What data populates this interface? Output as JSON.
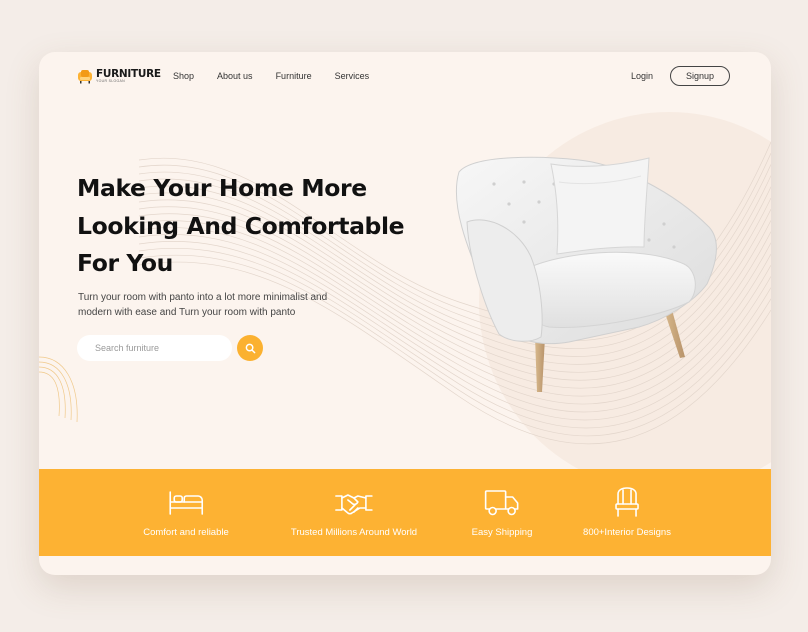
{
  "brand": {
    "name": "FURNITURE",
    "tagline": "YOUR SLOGAN",
    "logo_icon": "armchair-logo-icon"
  },
  "nav": {
    "items": [
      {
        "label": "Shop"
      },
      {
        "label": "About us"
      },
      {
        "label": "Furniture"
      },
      {
        "label": "Services"
      }
    ]
  },
  "auth": {
    "login_label": "Login",
    "signup_label": "Signup"
  },
  "hero": {
    "title_lines": [
      "Make Your Home More",
      "Looking And Comfortable",
      "For You"
    ],
    "subtitle": "Turn your room with panto into a lot more minimalist and modern with ease and Turn your room with panto",
    "search_placeholder": "Search furniture",
    "search_icon": "search-icon",
    "image": "white-armchair"
  },
  "features": [
    {
      "label": "Comfort and reliable",
      "icon": "bed-icon"
    },
    {
      "label": "Trusted Millions Around World",
      "icon": "handshake-icon"
    },
    {
      "label": "Easy Shipping",
      "icon": "truck-icon"
    },
    {
      "label": "800+Interior Designs",
      "icon": "chair-icon"
    }
  ],
  "colors": {
    "accent": "#FDB233",
    "page_bg": "#F4EDE8",
    "card_bg": "#FCF4EE",
    "text_dark": "#111111"
  }
}
